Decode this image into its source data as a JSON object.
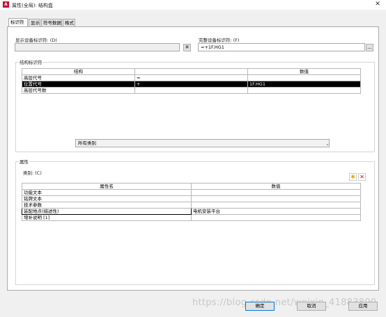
{
  "window": {
    "title": "属性(全局): 结构盒",
    "app_icon_glyph": "A",
    "close_glyph": "✕"
  },
  "tabs": [
    {
      "label": "标识符",
      "active": true
    },
    {
      "label": "显示",
      "active": false
    },
    {
      "label": "符号数据",
      "active": false
    },
    {
      "label": "格式",
      "active": false
    }
  ],
  "identifier": {
    "display_id_label": "显示设备标识符: (D)",
    "display_id_value": "",
    "clear_icon": "clear-icon",
    "full_id_label": "完整设备标识符: (F)",
    "full_id_value": "=+1F.HG1",
    "browse_label": "..."
  },
  "structure_group": {
    "title": "结构标识符",
    "headers": [
      "结构",
      "",
      "数值"
    ],
    "rows": [
      {
        "cells": [
          "高层代号",
          "=",
          ""
        ],
        "selected": false
      },
      {
        "cells": [
          "位置代号",
          "+",
          "1F.HG1"
        ],
        "selected": true
      },
      {
        "cells": [
          "高层代号数",
          "",
          ""
        ],
        "selected": false
      }
    ]
  },
  "properties_group": {
    "title": "属性",
    "category_label": "类别: (C)",
    "category_value": "所有类别",
    "add_icon": "star-icon",
    "delete_icon": "delete-icon",
    "headers": [
      "属性名",
      "数值"
    ],
    "rows": [
      {
        "cells": [
          "功能文本",
          ""
        ]
      },
      {
        "cells": [
          "铭牌文本",
          ""
        ]
      },
      {
        "cells": [
          "技术参数",
          ""
        ]
      },
      {
        "cells": [
          "装配地点(描述性)",
          "电机安装平台"
        ]
      },
      {
        "cells": [
          "增补说明 [1]",
          ""
        ]
      }
    ]
  },
  "footer": {
    "ok_label": "确定",
    "cancel_label": "取消",
    "apply_label": "应用"
  },
  "watermark": "https://blog.csdn.net/weixin_41883890"
}
